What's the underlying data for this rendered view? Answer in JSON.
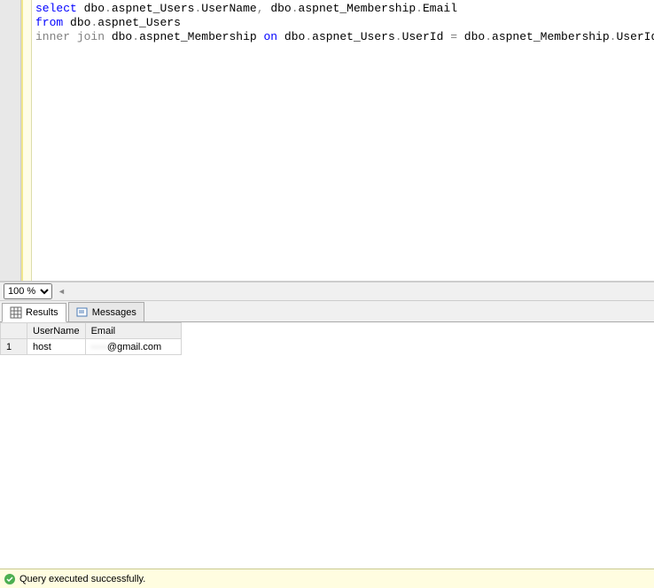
{
  "editor": {
    "line1_select": "select",
    "line1_rest": " dbo",
    "line1_dot1": ".",
    "line1_t1": "aspnet_Users",
    "line1_dot2": ".",
    "line1_c1": "UserName",
    "line1_comma": ",",
    "line1_t2": " dbo",
    "line1_dot3": ".",
    "line1_t2b": "aspnet_Membership",
    "line1_dot4": ".",
    "line1_c2": "Email",
    "line2_from": "from",
    "line2_rest": " dbo",
    "line2_dot1": ".",
    "line2_t1": "aspnet_Users",
    "line3_inner": "inner",
    "line3_join": " join",
    "line3_r1": " dbo",
    "line3_dot1": ".",
    "line3_t1": "aspnet_Membership ",
    "line3_on": "on",
    "line3_r2": " dbo",
    "line3_dot2": ".",
    "line3_t2": "aspnet_Users",
    "line3_dot3": ".",
    "line3_c1": "UserId ",
    "line3_eq": "=",
    "line3_r3": " dbo",
    "line3_dot4": ".",
    "line3_t3": "aspnet_Membership",
    "line3_dot5": ".",
    "line3_c2": "UserId"
  },
  "zoom": {
    "value": "100 %"
  },
  "tabs": {
    "results": "Results",
    "messages": "Messages"
  },
  "grid": {
    "headers": {
      "rownum": "",
      "username": "UserName",
      "email": "Email"
    },
    "rows": [
      {
        "num": "1",
        "username": "host",
        "email_hidden": "·····",
        "email_suffix": "@gmail.com"
      }
    ]
  },
  "status": {
    "message": "Query executed successfully."
  }
}
